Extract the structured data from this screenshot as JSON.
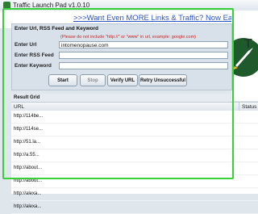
{
  "window": {
    "title": "Traffic Launch Pad v1.0.10"
  },
  "promo": {
    "link_text": ">>>Want Even MORE Links & Traffic? Now Easy This Is..."
  },
  "panel": {
    "title": "Enter Url, RSS Feed and Keyword",
    "hint": "(Please do not include \"http://\" or \"www\" in url, example: google.com)",
    "url_label": "Enter Url",
    "url_value": "intomenopause.com",
    "rss_label": "Enter RSS Feed",
    "rss_value": "",
    "keyword_label": "Enter Keyword",
    "keyword_value": ""
  },
  "buttons": {
    "start": "Start",
    "stop": "Stop",
    "verify": "Verify URL",
    "retry": "Retry Unsuccessful"
  },
  "grid": {
    "title": "Result Grid",
    "columns": {
      "url": "URL",
      "status": "Status"
    },
    "rows": [
      "http://114be...",
      "http://114se...",
      "http://51.la...",
      "http://a.55...",
      "http://about...",
      "http://about...",
      "http://alexa...",
      "http://alexa..."
    ]
  },
  "side": {
    "letter": "T"
  },
  "colors": {
    "frame": "#35d136",
    "link": "#2a55c8",
    "hint": "#d42020"
  }
}
